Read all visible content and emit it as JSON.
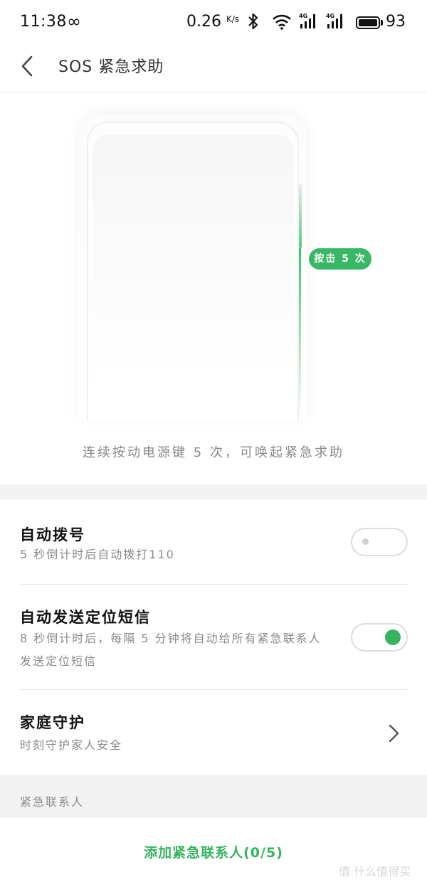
{
  "status_bar": {
    "time": "11:38",
    "infinity": "∞",
    "net_speed": "0.26",
    "net_speed_unit": "K/s",
    "signal_label_1": "4G",
    "signal_label_2": "4G",
    "battery_level": "93"
  },
  "header": {
    "title": "SOS 紧急求助",
    "back_icon": "chevron-left-icon"
  },
  "illustration": {
    "badge": "按击 5 次",
    "hint": "连续按动电源键 5 次，可唤起紧急求助",
    "accent_color": "#34b45e"
  },
  "settings": {
    "auto_dial": {
      "title": "自动拨号",
      "subtitle": "5 秒倒计时后自动拨打110",
      "enabled": false
    },
    "auto_sms": {
      "title": "自动发送定位短信",
      "subtitle": "8 秒倒计时后，每隔 5 分钟将自动给所有紧急联系人发送定位短信",
      "enabled": true
    },
    "family_guard": {
      "title": "家庭守护",
      "subtitle": "时刻守护家人安全"
    }
  },
  "contacts": {
    "section_label": "紧急联系人",
    "add_button": "添加紧急联系人(0/5)"
  },
  "watermark": "值 什么值得买"
}
